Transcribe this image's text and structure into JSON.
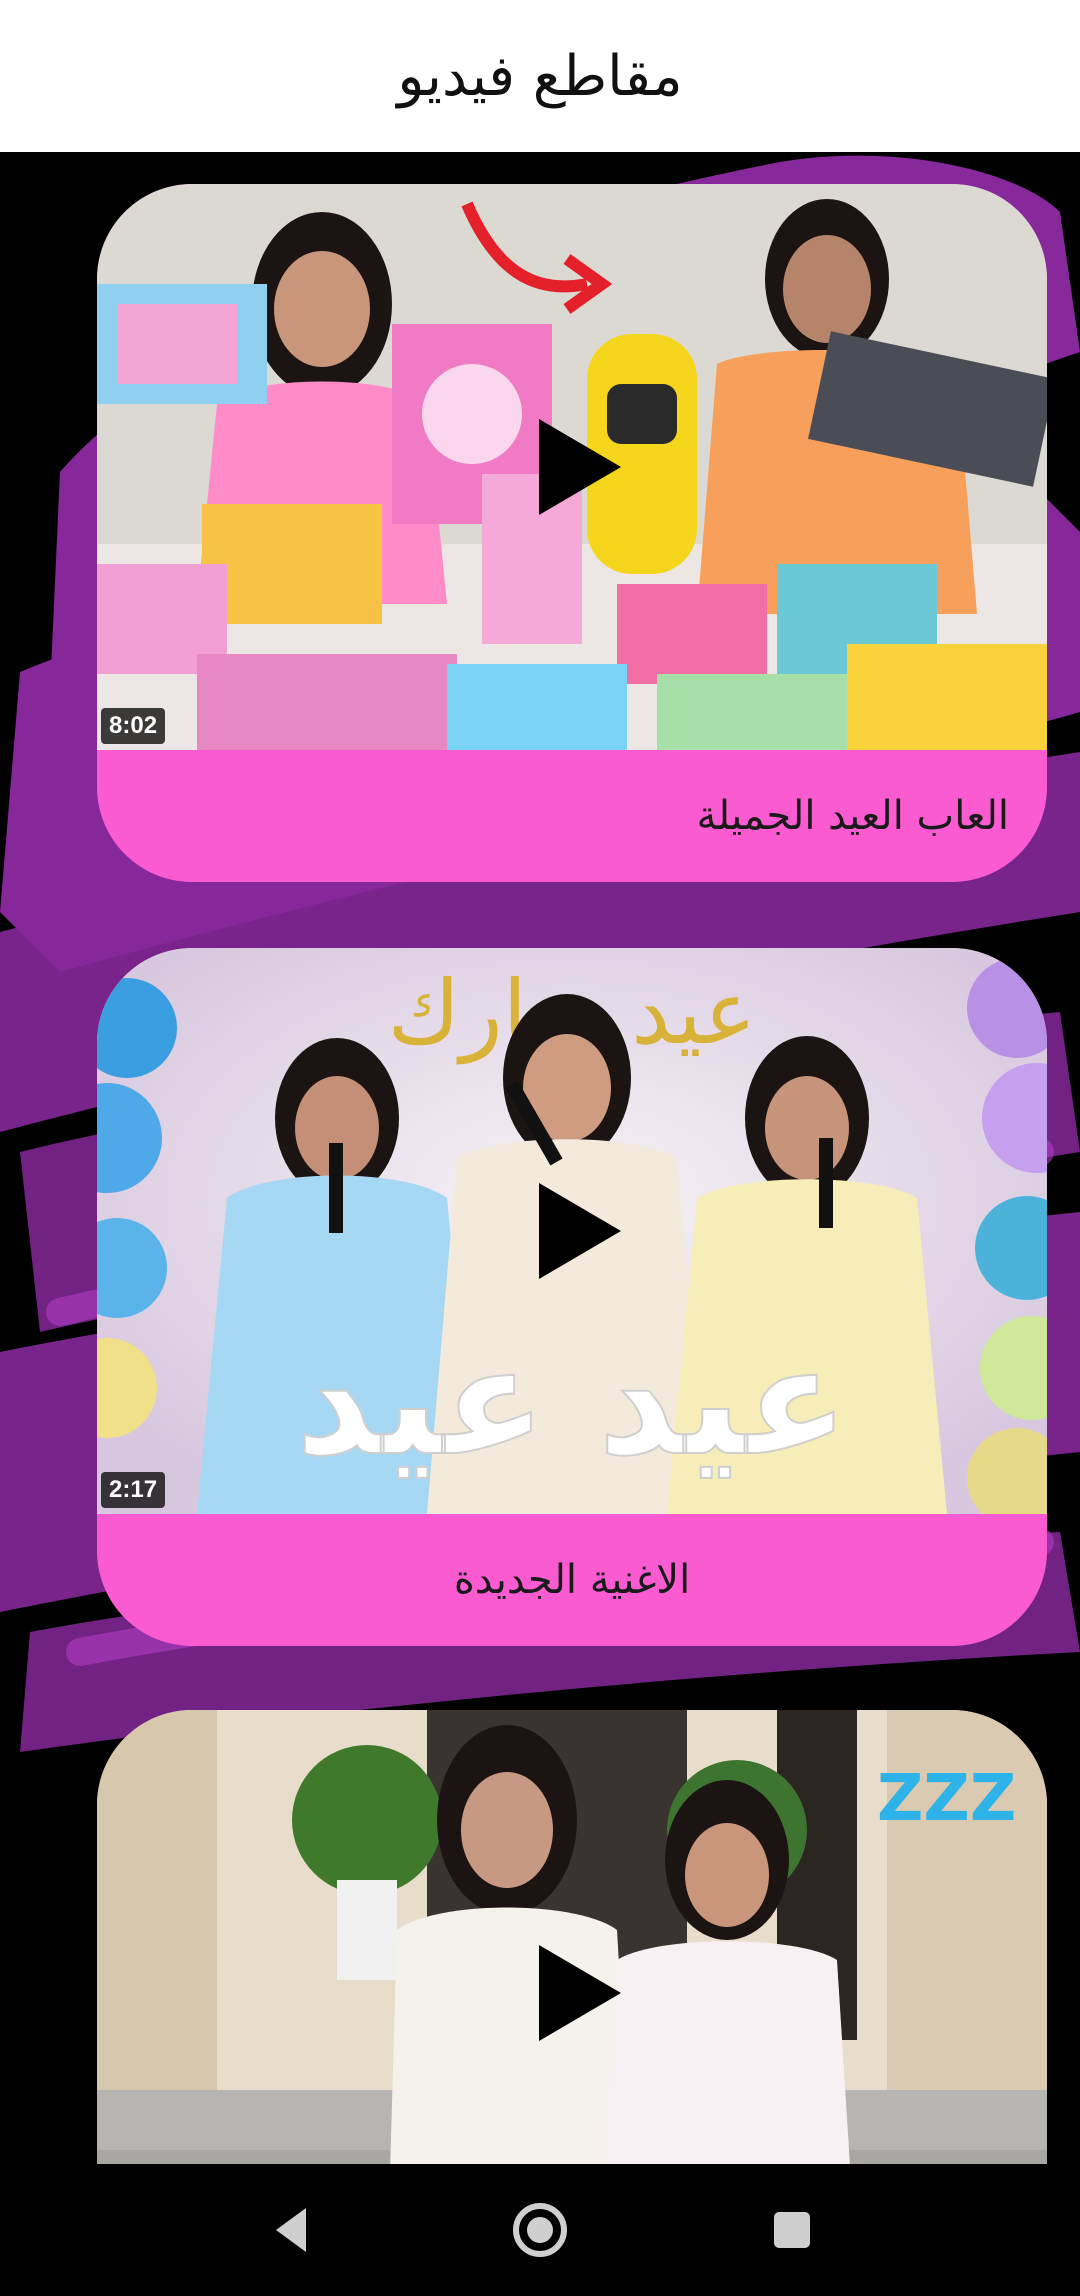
{
  "header": {
    "title": "مقاطع فيديو"
  },
  "colors": {
    "card_pink": "#fb5bd0",
    "background": "#000000",
    "accent_purple": "#9b2fb0"
  },
  "videos": [
    {
      "title": "العاب العيد الجميلة",
      "duration": "8:02",
      "thumbnail": "girls-with-toys-thumbnail"
    },
    {
      "title": "الاغنية الجديدة",
      "duration": "2:17",
      "thumbnail": "girls-singing-eid-thumbnail",
      "thumbnail_text": "عيد عيد",
      "banner_text": "عيد مبارك"
    },
    {
      "title": "",
      "duration": "",
      "thumbnail": "sleepy-girls-thumbnail",
      "thumbnail_text": "ZZZ"
    }
  ],
  "navbar": {
    "back": "back-icon",
    "home": "home-icon",
    "recents": "recents-icon"
  }
}
